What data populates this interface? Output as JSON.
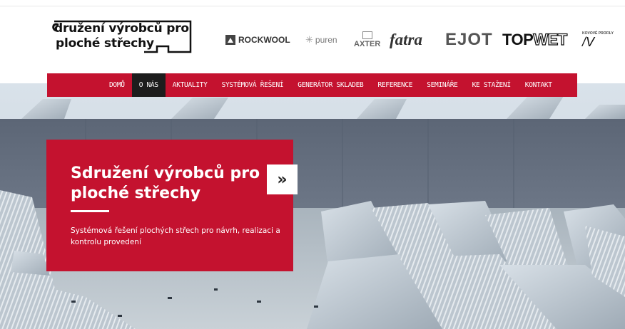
{
  "logo": {
    "line1": "družení výrobců pro",
    "line2": "ploché střechy"
  },
  "partners": [
    {
      "name": "ROCKWOOL",
      "icon": "rockwool-triangle-icon"
    },
    {
      "name": "puren"
    },
    {
      "name": "AXTER"
    },
    {
      "name": "fatra"
    },
    {
      "name": "EJOT"
    },
    {
      "name_a": "TOP",
      "name_b": "WET"
    },
    {
      "tagline": "KOVOVÉ PROFILY",
      "mark": "/V"
    }
  ],
  "nav": {
    "items": [
      {
        "label": "DOMŮ"
      },
      {
        "label": "O NÁS",
        "active": true
      },
      {
        "label": "AKTUALITY"
      },
      {
        "label": "SYSTÉMOVÁ ŘEŠENÍ"
      },
      {
        "label": "GENERÁTOR SKLADEB"
      },
      {
        "label": "REFERENCE"
      },
      {
        "label": "SEMINÁŘE"
      },
      {
        "label": "KE STAŽENÍ"
      },
      {
        "label": "KONTAKT"
      }
    ]
  },
  "hero": {
    "title": "Sdružení výrobců pro ploché střechy",
    "subtitle": "Systémová řešení plochých střech pro návrh, realizaci a kontrolu provedení",
    "next_icon": "»"
  },
  "colors": {
    "brand_red": "#c4122f",
    "nav_active": "#1d1d1d"
  }
}
